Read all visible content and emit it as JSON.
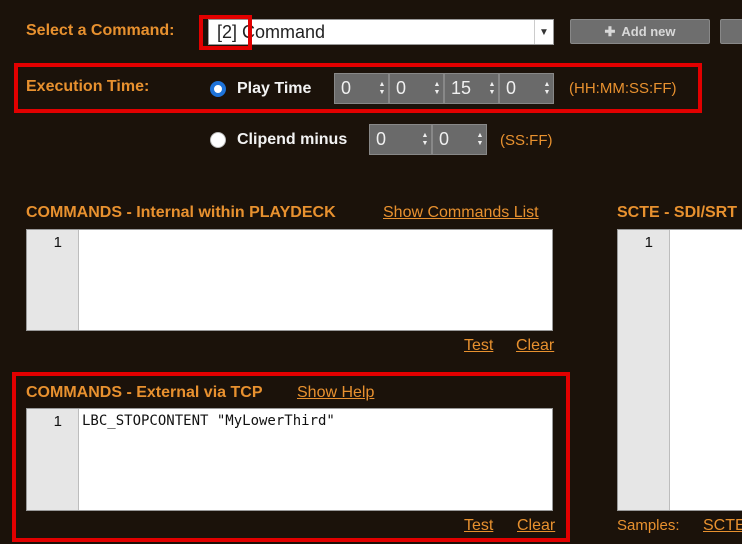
{
  "select_command": {
    "label": "Select a Command:",
    "value": "[2] Command",
    "add_new_label": "Add new",
    "add_new_icon": "plus-icon"
  },
  "execution": {
    "label": "Execution Time:",
    "play_time": {
      "label": "Play Time",
      "selected": true,
      "fields": [
        "0",
        "0",
        "15",
        "0"
      ],
      "format": "(HH:MM:SS:FF)"
    },
    "clipend": {
      "label": "Clipend minus",
      "selected": false,
      "fields": [
        "0",
        "0"
      ],
      "format": "(SS:FF)"
    }
  },
  "commands_internal": {
    "title": "COMMANDS - Internal within PLAYDECK",
    "link": "Show Commands List",
    "line_numbers": [
      "1"
    ],
    "content": "",
    "test_label": "Test",
    "clear_label": "Clear"
  },
  "commands_external": {
    "title": "COMMANDS - External via TCP",
    "link": "Show Help",
    "line_numbers": [
      "1"
    ],
    "content": "LBC_STOPCONTENT \"MyLowerThird\"",
    "test_label": "Test",
    "clear_label": "Clear"
  },
  "scte": {
    "title": "SCTE - SDI/SRT",
    "line_numbers": [
      "1"
    ],
    "samples_label": "Samples:",
    "samples_link": "SCTE"
  },
  "colors": {
    "background": "#1b120a",
    "accent": "#e8912f",
    "highlight": "#e20000",
    "radio_selected": "#1e73d9"
  }
}
